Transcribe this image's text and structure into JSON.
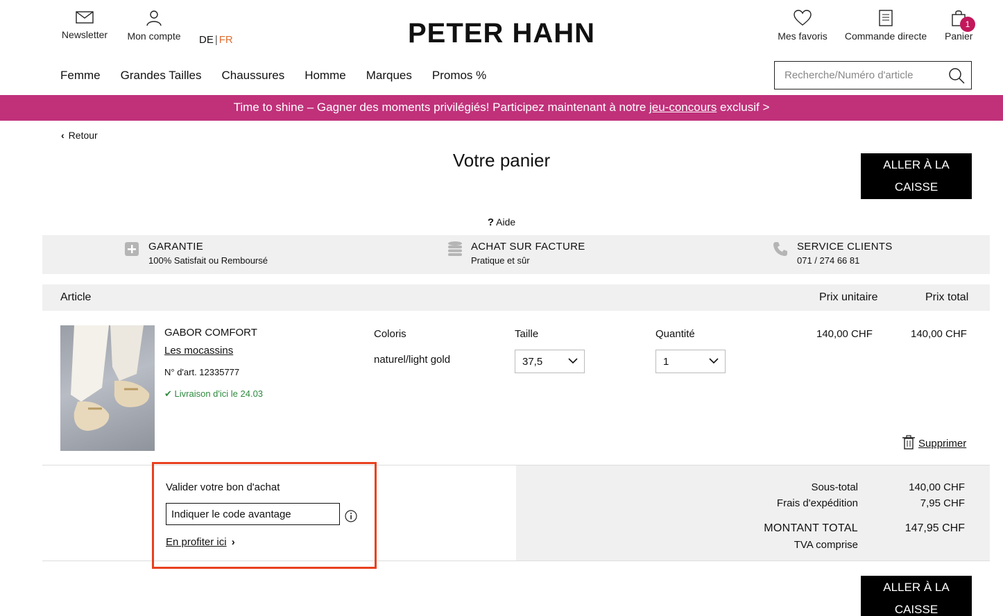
{
  "header": {
    "newsletter_label": "Newsletter",
    "account_label": "Mon compte",
    "lang_de": "DE",
    "lang_sep": "|",
    "lang_fr": "FR",
    "logo": "PETER HAHN",
    "favorites_label": "Mes favoris",
    "direct_order_label": "Commande directe",
    "cart_label": "Panier",
    "cart_count": "1"
  },
  "nav": {
    "items": [
      "Femme",
      "Grandes Tailles",
      "Chaussures",
      "Homme",
      "Marques",
      "Promos %"
    ]
  },
  "search": {
    "placeholder": "Recherche/Numéro d'article"
  },
  "banner": {
    "prefix": "Time to shine – Gagner des moments privilégiés! Participez maintenant à notre ",
    "link": "jeu-concours",
    "suffix": " exclusif >"
  },
  "page": {
    "back_label": "Retour",
    "title": "Votre panier",
    "checkout_line1": "ALLER À LA",
    "checkout_line2": "CAISSE",
    "help_mark": "?",
    "help_label": "Aide"
  },
  "usp": [
    {
      "title": "GARANTIE",
      "sub": "100% Satisfait ou Remboursé",
      "icon": "plus-box-icon"
    },
    {
      "title": "ACHAT SUR FACTURE",
      "sub": "Pratique et sûr",
      "icon": "coin-stack-icon"
    },
    {
      "title": "SERVICE CLIENTS",
      "sub": "071 / 274 66 81",
      "icon": "phone-icon"
    }
  ],
  "table": {
    "col_article": "Article",
    "col_unit_price": "Prix unitaire",
    "col_total_price": "Prix total"
  },
  "item": {
    "brand": "GABOR COMFORT",
    "name": "Les mocassins",
    "article_no": "N° d'art. 12335777",
    "delivery": "Livraison d'ici le 24.03",
    "color_label": "Coloris",
    "color_value": "naturel/light gold",
    "size_label": "Taille",
    "size_value": "37,5",
    "qty_label": "Quantité",
    "qty_value": "1",
    "unit_price": "140,00 CHF",
    "total_price": "140,00 CHF",
    "delete_label": "Supprimer"
  },
  "voucher": {
    "title": "Valider votre bon d'achat",
    "placeholder": "Indiquer le code avantage",
    "cta": "En profiter ici"
  },
  "totals": {
    "subtotal_label": "Sous-total",
    "subtotal_value": "140,00 CHF",
    "shipping_label": "Frais d'expédition",
    "shipping_value": "7,95 CHF",
    "grand_label": "MONTANT TOTAL",
    "grand_value": "147,95 CHF",
    "vat_label": "TVA comprise"
  },
  "colors": {
    "accent_banner": "#c0317a",
    "badge": "#c2185b",
    "lang_active": "#e06d2f",
    "in_stock": "#2e8a3e",
    "highlight": "#e8411f"
  }
}
